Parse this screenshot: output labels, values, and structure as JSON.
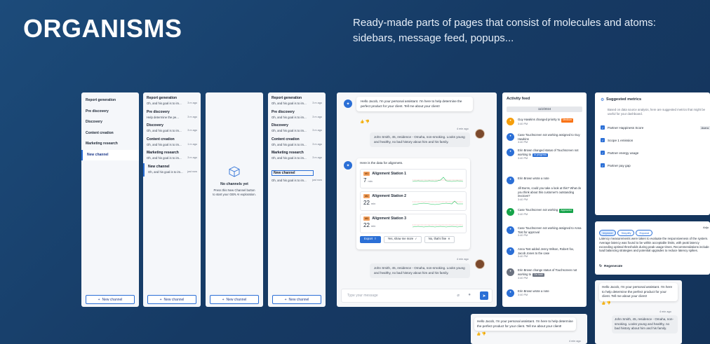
{
  "hero": {
    "title": "ORGANISMS",
    "description": "Ready-made parts of pages that consist of molecules and atoms: sidebars, message feed, popups..."
  },
  "sidebar_simple": {
    "items": [
      "Report generation",
      "Pre discovery",
      "Discovery",
      "Content creation",
      "Marketing research",
      "New channel"
    ],
    "new_channel_label": "New channel"
  },
  "sidebar_detailed": {
    "items": [
      {
        "title": "Report generation",
        "preview": "Oh, and his goal is to im...",
        "time": "3 m ago"
      },
      {
        "title": "Pre discovery",
        "preview": "Help determine the pe...",
        "time": "3 m ago"
      },
      {
        "title": "Discovery",
        "preview": "Oh, and his goal is to im...",
        "time": "3 m ago"
      },
      {
        "title": "Content creation",
        "preview": "Oh, and his goal is to im...",
        "time": "1 m ago"
      },
      {
        "title": "Marketing research",
        "preview": "Oh, and his goal is to im...",
        "time": "3 m ago"
      },
      {
        "title": "New channel",
        "preview": "Oh, and his goal is to im...",
        "time": "just now"
      }
    ],
    "new_channel_label": "New channel"
  },
  "empty_state": {
    "title": "No channels yet",
    "body": "Press this New Channel button to start your GEN AI exploration.",
    "new_channel_label": "New channel"
  },
  "sidebar_detailed_2": {
    "items": [
      {
        "title": "Report generation",
        "preview": "Oh, and his goal is to im...",
        "time": "3 m ago"
      },
      {
        "title": "Pre discovery",
        "preview": "Oh, and his goal is to im...",
        "time": "3 m ago"
      },
      {
        "title": "Discovery",
        "preview": "Oh, and his goal is to im...",
        "time": "3 m ago"
      },
      {
        "title": "Content creation",
        "preview": "Oh, and his goal is to im...",
        "time": "3 m ago"
      },
      {
        "title": "Marketing research",
        "preview": "Oh, and his goal is to im...",
        "time": "3 m ago"
      },
      {
        "title": "New channel",
        "preview": "Oh, and his goal is to im...",
        "time": "just now"
      }
    ],
    "new_channel_label": "New channel"
  },
  "chat": {
    "bot_intro": "Hello Jacob, I'm your personal assistant. I'm here to help determine the perfect product for your client. Tell me about your client!",
    "user_time_1": "4 min ago",
    "user_msg_1": "John Smith, 45, residence - Omaha, non-smoking. Looks young and healthy, no bad history about him and his family.",
    "bot_data_intro": "Here is the data for alignmets.",
    "stations": [
      {
        "badge": "M1",
        "name": "Alignment Station 1",
        "value": "7",
        "unit": "min"
      },
      {
        "badge": "M2",
        "name": "Alignment Station 2",
        "value": "22",
        "unit": "min"
      },
      {
        "badge": "M3",
        "name": "Alignment Station 3",
        "value": "22",
        "unit": "min"
      }
    ],
    "export_label": "Export",
    "show_more_label": "Yes, show me more",
    "thats_fine_label": "No, that's fine",
    "user_time_2": "4 min ago",
    "user_msg_2": "John Smith, 45, residence - Omaha, non-smoking. Looks young and healthy, no bad history about him and his family.",
    "input_placeholder": "Type your message"
  },
  "activity": {
    "title": "Activity feed",
    "date": "11/2/2024",
    "entries": [
      {
        "text": "Guy Hawkins changed priority to",
        "tag": "Medium",
        "time": "3:40 PM",
        "color": "#f59e0b"
      },
      {
        "text": "Case Touchscreen not working assigned to Guy Hawkins",
        "tag": "",
        "time": "3:40 PM",
        "color": "#2b6fd6"
      },
      {
        "text": "Erin Brown changed status of Touchscreen not working to",
        "tag": "In progress",
        "time": "3:40 PM",
        "color": "#2b6fd6"
      },
      {
        "text": "Erin Brown wrote a note",
        "tag": "",
        "time": "",
        "color": "#2b6fd6"
      },
      {
        "text": "Jill Burns, could you take a look at this? What do you think about this customer's outstanding invoices?",
        "tag": "",
        "time": "3:40 PM",
        "color": ""
      },
      {
        "text": "Case Touchscreen not working",
        "tag": "Approved",
        "time": "3:40 PM",
        "color": "#16a34a"
      },
      {
        "text": "Case Touchscreen not working assigned to Anna Tost for approval",
        "tag": "",
        "time": "3:40 PM",
        "color": "#2b6fd6"
      },
      {
        "text": "Anna Tost added Jenny Wilson, Robert fox, Jacob Jones to the case",
        "tag": "",
        "time": "3:40 PM",
        "color": "#2b6fd6"
      },
      {
        "text": "Erin Brown change status of Touchscreen not working to",
        "tag": "On hold",
        "time": "3:40 PM",
        "color": "#6b7280"
      },
      {
        "text": "Erin Brown wrote a note",
        "tag": "",
        "time": "3:40 PM",
        "color": "#2b6fd6"
      }
    ]
  },
  "metrics": {
    "title": "Suggested metrics",
    "intro": "Based on data source analysis, here are suggested metrics that might be useful for your dashboard.",
    "rows": [
      "Partner Happiness Score",
      "Scope 1 emission",
      "Partner energy usage",
      "Partner pay gap"
    ],
    "first_badge": "Avera"
  },
  "improve": {
    "pills": [
      "Improve",
      "Simplify",
      "Expand"
    ],
    "corner": "Adju",
    "text": "Latency measurements were taken to evaluate the responsiveness of the system. Average latency was found to be within acceptable limits, with peak latency exceeding optimal thresholds during peak usage times. Recommendations include load balancing strategies and potential upgrades to reduce latency spikes.",
    "regen": "Regenerate"
  },
  "mini_chat_1": {
    "bot": "Hello Jacob, I'm your personal assistant. I'm here to help determine the perfect product for your client. Tell me about your client!",
    "time": "4 min ago",
    "user": "John Smith, 45, residence - Omaha, non-smoking. Looks young and healthy, no bad history about him and his family."
  },
  "mini_chat_2": {
    "bot": "Hello Jacob, I'm your personal assistant. I'm here to help determine the perfect product for your client. Tell me about your client!",
    "time": "4 min ago"
  }
}
